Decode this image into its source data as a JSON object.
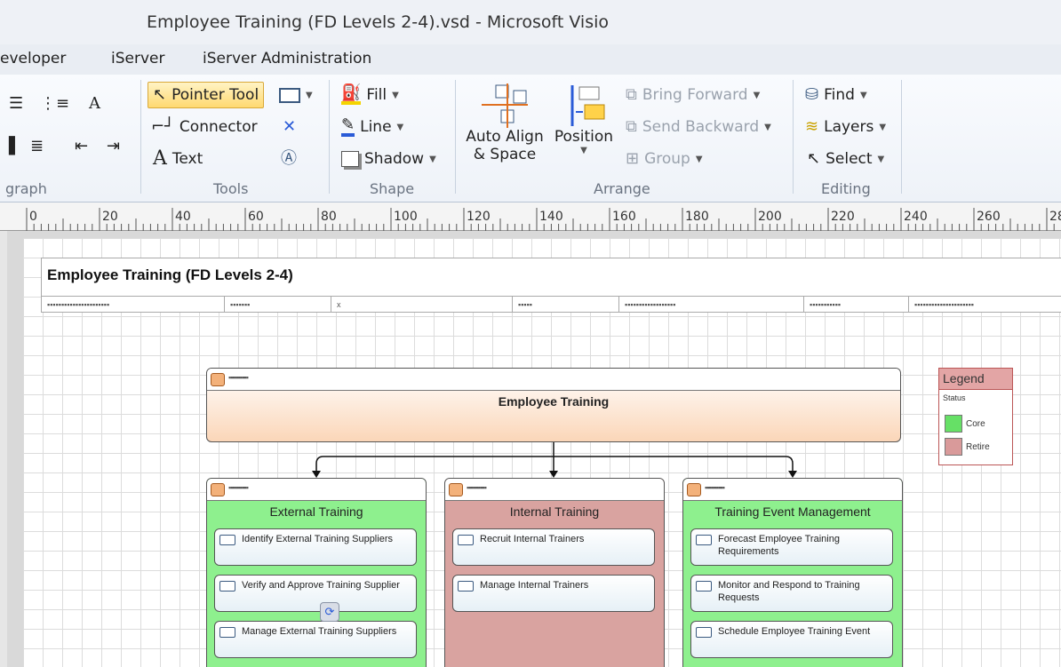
{
  "window": {
    "title": "Employee Training (FD Levels 2-4).vsd  -  Microsoft Visio"
  },
  "tabs": [
    "eveloper",
    "iServer",
    "iServer Administration"
  ],
  "ribbon": {
    "paragraph_label": "graph",
    "tools": {
      "label": "Tools",
      "pointer": "Pointer Tool",
      "connector": "Connector",
      "text": "Text"
    },
    "shape": {
      "label": "Shape",
      "fill": "Fill",
      "line": "Line",
      "shadow": "Shadow"
    },
    "arrange": {
      "label": "Arrange",
      "auto_align_1": "Auto Align",
      "auto_align_2": "& Space",
      "position": "Position",
      "bring_forward": "Bring Forward",
      "send_backward": "Send Backward",
      "group": "Group"
    },
    "editing": {
      "label": "Editing",
      "find": "Find",
      "layers": "Layers",
      "select": "Select"
    }
  },
  "ruler": {
    "ticks": [
      "0",
      "20",
      "40",
      "60",
      "80",
      "100",
      "120",
      "140",
      "160",
      "180",
      "200",
      "220",
      "240",
      "260",
      "28"
    ]
  },
  "diagram": {
    "header_title": "Employee Training (FD Levels 2-4)",
    "header_cells": [
      "▪▪▪▪▪▪▪▪▪▪▪▪▪▪▪▪▪▪▪▪▪▪",
      "▪▪▪▪▪▪▪",
      "x",
      "▪▪▪▪▪",
      "▪▪▪▪▪▪▪▪▪▪▪▪▪▪▪▪▪▪",
      "▪▪▪▪▪▪▪▪▪▪▪",
      "▪▪▪▪▪▪▪▪▪▪▪▪▪▪▪▪▪▪▪▪▪"
    ],
    "root": {
      "id": "▪▪▪▪▪▪▪▪▪▪",
      "name": "Employee Training"
    },
    "columns": [
      {
        "id": "▪▪▪▪▪▪▪▪▪▪",
        "name": "External Training",
        "color": "#8ef08e",
        "items": [
          "Identify External Training Suppliers",
          "Verify and Approve Training Supplier",
          "Manage External Training Suppliers"
        ]
      },
      {
        "id": "▪▪▪▪▪▪▪▪▪▪",
        "name": "Internal Training",
        "color": "#d9a3a0",
        "items": [
          "Recruit Internal Trainers",
          "Manage Internal Trainers"
        ]
      },
      {
        "id": "▪▪▪▪▪▪▪▪▪▪",
        "name": "Training Event Management",
        "color": "#8ef08e",
        "items": [
          "Forecast Employee Training Requirements",
          "Monitor and Respond to Training Requests",
          "Schedule Employee Training Event"
        ]
      }
    ],
    "legend": {
      "title": "Legend",
      "status": "Status",
      "core": "Core",
      "retire": "Retire",
      "core_color": "#66e066",
      "retire_color": "#d99a9a"
    }
  }
}
